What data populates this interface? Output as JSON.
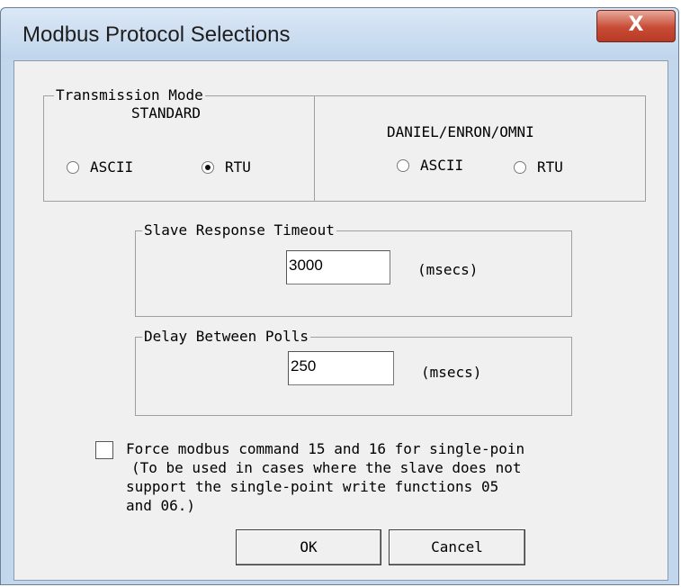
{
  "window": {
    "title": "Modbus Protocol Selections",
    "close_glyph": "X"
  },
  "transmission": {
    "legend": "Transmission Mode",
    "standard": {
      "header": "STANDARD",
      "ascii_label": "ASCII",
      "rtu_label": "RTU",
      "selected": "RTU"
    },
    "daniel": {
      "header": "DANIEL/ENRON/OMNI",
      "ascii_label": "ASCII",
      "rtu_label": "RTU",
      "selected": "none"
    }
  },
  "slave_timeout": {
    "legend": "Slave Response Timeout",
    "value": "3000",
    "unit": "(msecs)"
  },
  "delay_polls": {
    "legend": "Delay Between Polls",
    "value": "250",
    "unit": "(msecs)"
  },
  "force_option": {
    "checked": false,
    "line1": "Force modbus command 15 and 16 for single-poin",
    "line2": "(To be used in cases where the slave does not",
    "line3": "support the single-point write functions 05",
    "line4": "and 06.)"
  },
  "buttons": {
    "ok_label": "OK",
    "cancel_label": "Cancel"
  }
}
